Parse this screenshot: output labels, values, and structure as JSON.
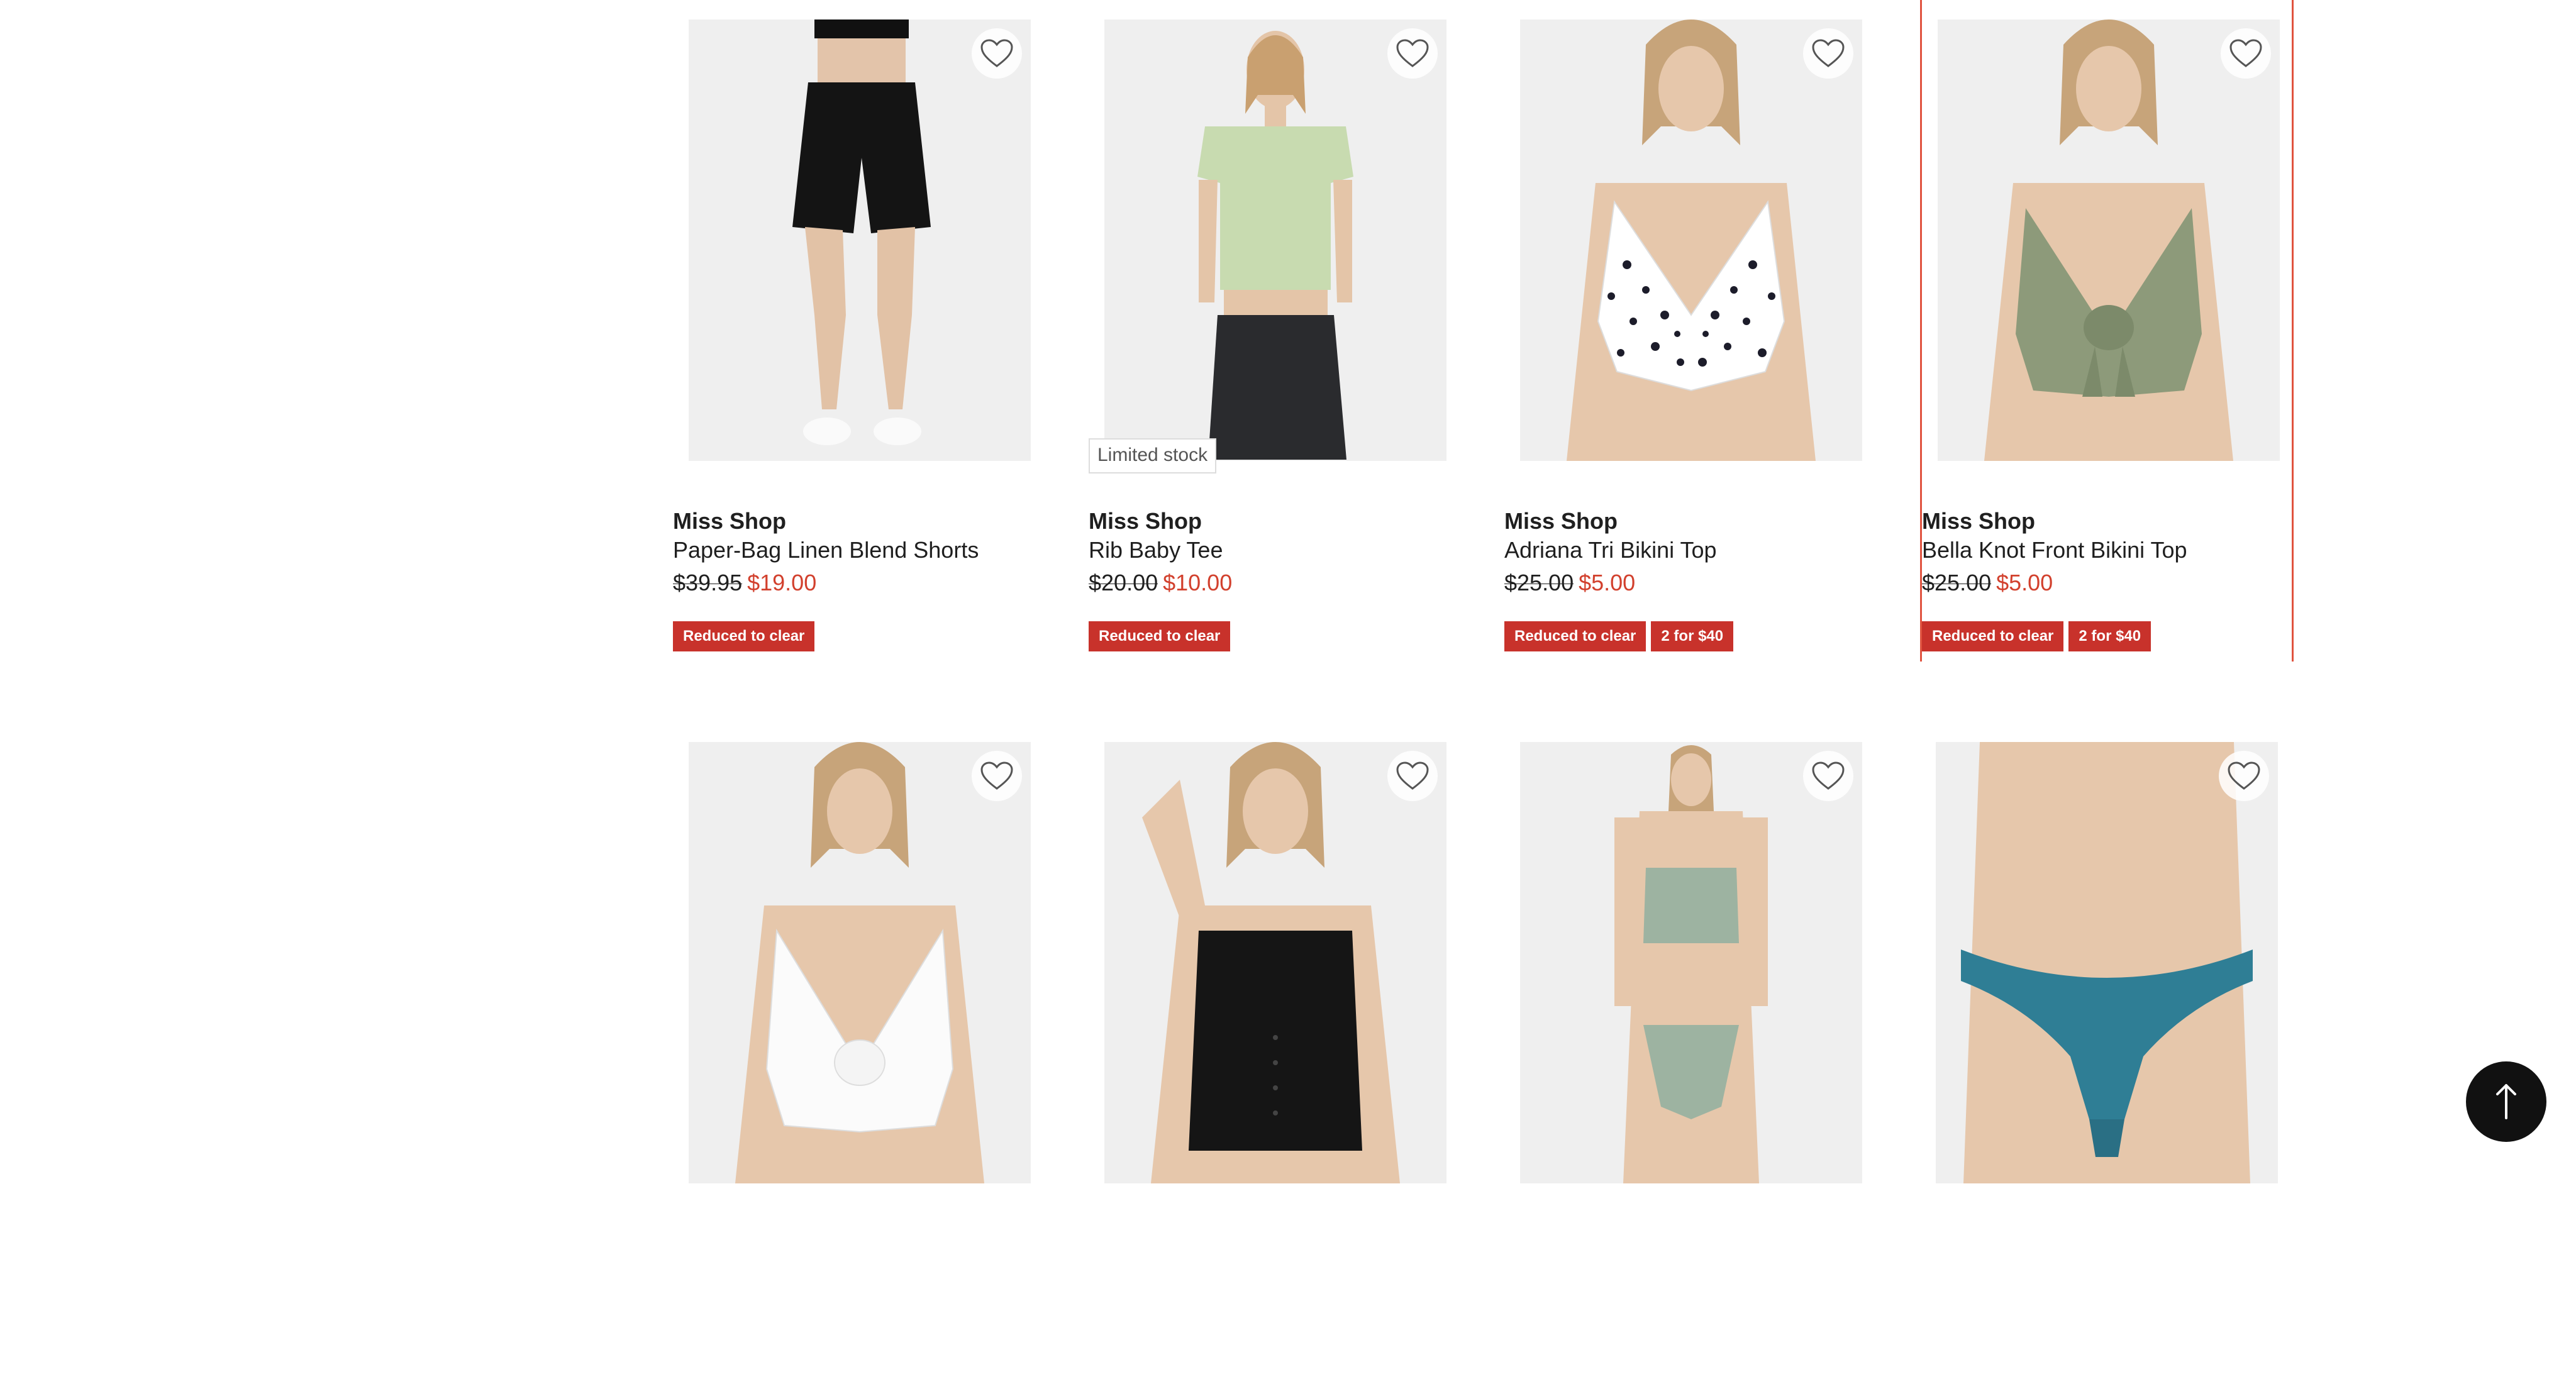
{
  "products": [
    {
      "brand": "Miss Shop",
      "name": "Paper-Bag Linen Blend Shorts",
      "price_was": "$39.95",
      "price_now": "$19.00",
      "stock_label": "",
      "badges": [
        "Reduced to clear"
      ],
      "image": "model-black-shorts"
    },
    {
      "brand": "Miss Shop",
      "name": "Rib Baby Tee",
      "price_was": "$20.00",
      "price_now": "$10.00",
      "stock_label": "Limited stock",
      "badges": [
        "Reduced to clear"
      ],
      "image": "model-sage-tee"
    },
    {
      "brand": "Miss Shop",
      "name": "Adriana Tri Bikini Top",
      "price_was": "$25.00",
      "price_now": "$5.00",
      "stock_label": "",
      "badges": [
        "Reduced to clear",
        "2 for $40"
      ],
      "image": "model-spotted-bikini-top"
    },
    {
      "brand": "Miss Shop",
      "name": "Bella Knot Front Bikini Top",
      "price_was": "$25.00",
      "price_now": "$5.00",
      "stock_label": "",
      "badges": [
        "Reduced to clear",
        "2 for $40"
      ],
      "image": "model-khaki-knot-top"
    },
    {
      "image": "model-white-knot-top"
    },
    {
      "image": "model-black-crop-top"
    },
    {
      "image": "model-sage-bikini-set"
    },
    {
      "image": "model-teal-bikini-bottom"
    }
  ],
  "colors": {
    "sale_price": "#d2402d",
    "badge_bg": "#c8322b",
    "highlight_border": "#e0533f",
    "back_to_top_bg": "#111111"
  },
  "icons": {
    "wishlist": "heart-icon",
    "back_to_top": "arrow-up-icon"
  }
}
